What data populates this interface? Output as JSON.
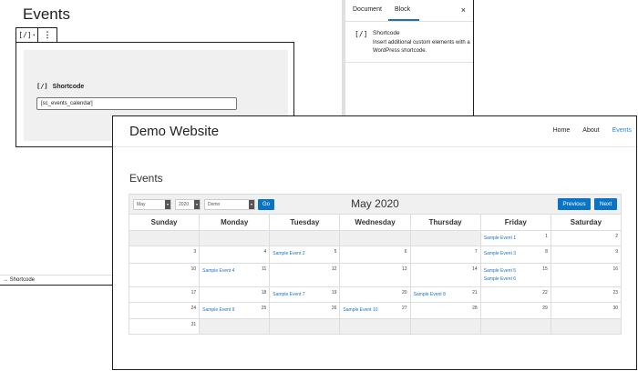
{
  "editor": {
    "title": "Events",
    "toolbar": {
      "shortcode_icon": "[/]",
      "shortcode_arrow": "▾",
      "more_icon": "⋮"
    },
    "block": {
      "label_icon": "[/]",
      "label": "Shortcode",
      "input_value": "[sc_events_calendar]"
    },
    "breadcrumb": "→ Shortcode"
  },
  "sidebar": {
    "tabs": [
      {
        "label": "Document"
      },
      {
        "label": "Block"
      }
    ],
    "close": "×",
    "block_icon": "[/]",
    "block_name": "Shortcode",
    "block_description": "Insert additional custom elements with a WordPress shortcode.",
    "accent_color": "#2271b1"
  },
  "site": {
    "title": "Demo Website",
    "nav": [
      {
        "label": "Home",
        "active": false
      },
      {
        "label": "About",
        "active": false
      },
      {
        "label": "Events",
        "active": true
      }
    ],
    "heading": "Events",
    "link_color": "#2a8ad8"
  },
  "calendar": {
    "filters": {
      "month": "May",
      "year": "2020",
      "category": "Demo",
      "go": "Go"
    },
    "month_title": "May 2020",
    "prev": "Previous",
    "next": "Next",
    "button_color": "#0a74c4",
    "weekdays": [
      "Sunday",
      "Monday",
      "Tuesday",
      "Wednesday",
      "Thursday",
      "Friday",
      "Saturday"
    ],
    "weeks": [
      [
        {
          "day": ""
        },
        {
          "day": ""
        },
        {
          "day": ""
        },
        {
          "day": ""
        },
        {
          "day": ""
        },
        {
          "day": "1",
          "events": [
            "Sample Event 1"
          ]
        },
        {
          "day": "2"
        }
      ],
      [
        {
          "day": "3"
        },
        {
          "day": "4"
        },
        {
          "day": "5",
          "events": [
            "Sample Event 2"
          ]
        },
        {
          "day": "6"
        },
        {
          "day": "7"
        },
        {
          "day": "8",
          "events": [
            "Sample Event 3"
          ]
        },
        {
          "day": "9"
        }
      ],
      [
        {
          "day": "10"
        },
        {
          "day": "11",
          "events": [
            "Sample Event 4"
          ]
        },
        {
          "day": "12"
        },
        {
          "day": "13"
        },
        {
          "day": "14"
        },
        {
          "day": "15",
          "events": [
            "Sample Event 5",
            "Sample Event 6"
          ]
        },
        {
          "day": "16"
        }
      ],
      [
        {
          "day": "17"
        },
        {
          "day": "18"
        },
        {
          "day": "19",
          "events": [
            "Sample Event 7"
          ]
        },
        {
          "day": "20"
        },
        {
          "day": "21",
          "events": [
            "Sample Event 8"
          ]
        },
        {
          "day": "22"
        },
        {
          "day": "23"
        }
      ],
      [
        {
          "day": "24"
        },
        {
          "day": "25",
          "events": [
            "Sample Event 9"
          ]
        },
        {
          "day": "26"
        },
        {
          "day": "27",
          "events": [
            "Sample Event 10"
          ]
        },
        {
          "day": "28"
        },
        {
          "day": "29"
        },
        {
          "day": "30"
        }
      ],
      [
        {
          "day": "31"
        },
        {
          "day": ""
        },
        {
          "day": ""
        },
        {
          "day": ""
        },
        {
          "day": ""
        },
        {
          "day": ""
        },
        {
          "day": ""
        }
      ]
    ]
  }
}
